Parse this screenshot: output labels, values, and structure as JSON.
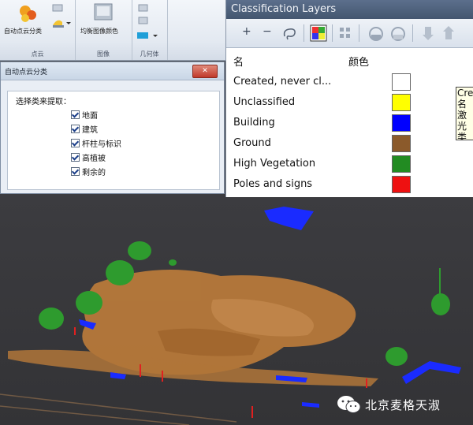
{
  "ribbon": {
    "auto_classify_label": "自动点云分类",
    "balance_image_label": "均衡图像颜色",
    "groups": [
      "点云",
      "图像",
      "几何体"
    ]
  },
  "dialog": {
    "title": "自动点云分类",
    "close": "✕",
    "select_label": "选择类来提取：",
    "options": [
      {
        "label": "地面",
        "checked": true
      },
      {
        "label": "建筑",
        "checked": true
      },
      {
        "label": "杆柱与标识",
        "checked": true
      },
      {
        "label": "高植被",
        "checked": true
      },
      {
        "label": "剩余的",
        "checked": true
      }
    ]
  },
  "layers_panel": {
    "title": "Classification Layers",
    "toolbar": {
      "add": "+",
      "remove": "−"
    },
    "columns": {
      "name": "名",
      "color": "颜色"
    },
    "rows": [
      {
        "name": "Created, never cl...",
        "color": "#ffffff"
      },
      {
        "name": "Unclassified",
        "color": "#ffff00"
      },
      {
        "name": "Building",
        "color": "#0000ff"
      },
      {
        "name": "Ground",
        "color": "#8b5a2b"
      },
      {
        "name": "High Vegetation",
        "color": "#228b22"
      },
      {
        "name": "Poles and signs",
        "color": "#ee1111"
      }
    ],
    "tooltip_lines": [
      "Cre",
      "名",
      "激光",
      "类标"
    ]
  },
  "viewport": {
    "colors": {
      "ground": "#b7793a",
      "building": "#1a2bff",
      "vegetation": "#2e9b2e",
      "poles": "#e02020"
    }
  },
  "watermark": {
    "text": "北京麦格天淑"
  }
}
